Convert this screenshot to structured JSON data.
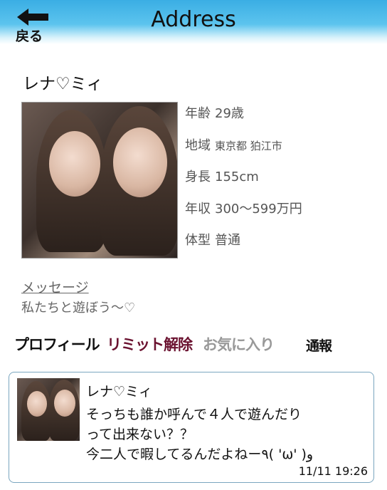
{
  "header": {
    "back_label": "戻る",
    "title": "Address"
  },
  "profile": {
    "name": "レナ♡ミィ",
    "fields": [
      {
        "key": "年齢",
        "value": "29歳"
      },
      {
        "key": "地域",
        "value": "東京都 狛江市"
      },
      {
        "key": "身長",
        "value": "155cm"
      },
      {
        "key": "年収",
        "value": "300〜599万円"
      },
      {
        "key": "体型",
        "value": "普通"
      }
    ],
    "message_label": "メッセージ",
    "message_text": "私たちと遊ぼう〜♡"
  },
  "tabs": [
    {
      "label": "プロフィール",
      "color": "#111111"
    },
    {
      "label": "リミット解除",
      "color": "#6b1230"
    },
    {
      "label": "お気に入り",
      "color": "#999999"
    },
    {
      "label": "通報",
      "color": "#111111"
    }
  ],
  "message_card": {
    "sender": "レナ♡ミィ",
    "lines": [
      "そっちも誰か呼んで４人で遊んだり",
      "って出来ない？？",
      "今二人で暇してるんだよねー٩( 'ω' )و"
    ],
    "time": "11/11 19:26"
  }
}
